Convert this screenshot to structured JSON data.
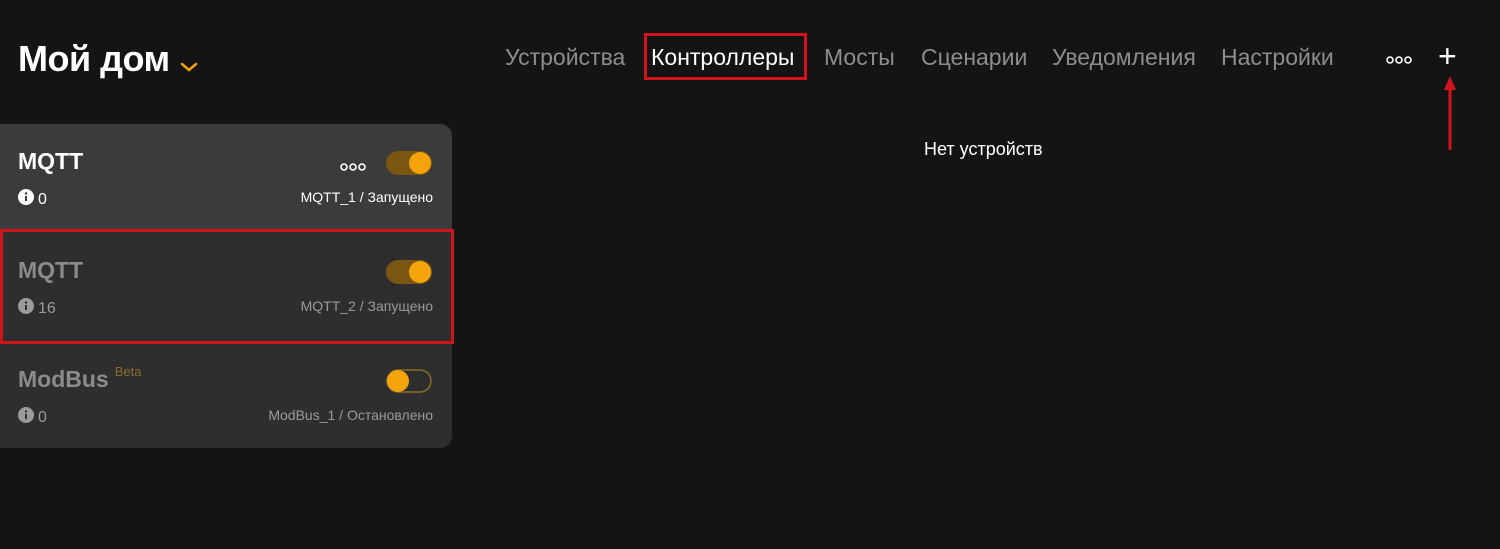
{
  "header": {
    "home_title": "Мой дом",
    "tabs": [
      {
        "label": "Устройства",
        "active": false
      },
      {
        "label": "Контроллеры",
        "active": true
      },
      {
        "label": "Мосты",
        "active": false
      },
      {
        "label": "Сценарии",
        "active": false
      },
      {
        "label": "Уведомления",
        "active": false
      },
      {
        "label": "Настройки",
        "active": false
      }
    ],
    "add_label": "+"
  },
  "controllers": [
    {
      "name": "MQTT",
      "count": "0",
      "status": "MQTT_1 / Запущено",
      "enabled": true,
      "has_menu": true
    },
    {
      "name": "MQTT",
      "count": "16",
      "status": "MQTT_2 / Запущено",
      "enabled": true,
      "has_menu": false
    },
    {
      "name": "ModBus",
      "badge": "Beta",
      "count": "0",
      "status": "ModBus_1 / Остановлено",
      "enabled": false,
      "has_menu": false
    }
  ],
  "main": {
    "empty_message": "Нет устройств"
  },
  "colors": {
    "background": "#141414",
    "accent": "#f5a30a",
    "highlight": "#d1141c",
    "card_bg": "#2e2e2e"
  }
}
